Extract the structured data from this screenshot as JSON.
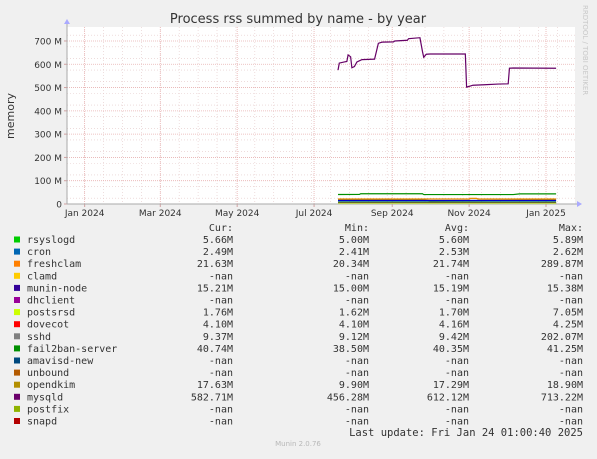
{
  "chart_data": {
    "type": "line",
    "title": "Process rss summed by name - by year",
    "ylabel": "memory",
    "watermark": "RRDTOOL / TOBI OETIKER",
    "x_tick_labels": [
      "Jan 2024",
      "Mar 2024",
      "May 2024",
      "Jul 2024",
      "Sep 2024",
      "Nov 2024",
      "Jan 2025"
    ],
    "x_ticks": [
      0,
      60,
      121,
      182,
      244,
      305,
      366
    ],
    "xlim": [
      -14,
      389
    ],
    "y_tick_labels": [
      "0",
      "100 M",
      "200 M",
      "300 M",
      "400 M",
      "500 M",
      "600 M",
      "700 M"
    ],
    "y_ticks": [
      0,
      100,
      200,
      300,
      400,
      500,
      600,
      700
    ],
    "ylim": [
      0,
      760
    ],
    "grid": true,
    "x_unit": "days since Jan 1 2024",
    "y_unit": "MB",
    "series": [
      {
        "name": "mysqld",
        "color": "#660066",
        "points": [
          [
            201,
            575
          ],
          [
            202,
            605
          ],
          [
            206,
            610
          ],
          [
            208,
            612
          ],
          [
            209,
            640
          ],
          [
            211,
            632
          ],
          [
            212,
            585
          ],
          [
            214,
            590
          ],
          [
            216,
            610
          ],
          [
            220,
            620
          ],
          [
            230,
            622
          ],
          [
            233,
            690
          ],
          [
            236,
            695
          ],
          [
            245,
            696
          ],
          [
            246,
            700
          ],
          [
            256,
            703
          ],
          [
            257,
            710
          ],
          [
            266,
            714
          ],
          [
            268,
            655
          ],
          [
            269,
            630
          ],
          [
            271,
            643
          ],
          [
            274,
            644
          ],
          [
            302,
            644
          ],
          [
            303,
            502
          ],
          [
            305,
            505
          ],
          [
            308,
            510
          ],
          [
            317,
            512
          ],
          [
            328,
            515
          ],
          [
            336,
            516
          ],
          [
            337,
            583
          ],
          [
            340,
            584
          ],
          [
            374,
            583
          ]
        ]
      },
      {
        "name": "fail2ban-server",
        "color": "#008f00",
        "points": [
          [
            201,
            40.7
          ],
          [
            218,
            41
          ],
          [
            219,
            44
          ],
          [
            268,
            44
          ],
          [
            269,
            40.5
          ],
          [
            340,
            40.5
          ],
          [
            345,
            43.5
          ],
          [
            374,
            43.5
          ]
        ]
      },
      {
        "name": "freshclam",
        "color": "#ea8f00",
        "points": [
          [
            201,
            21.6
          ],
          [
            305,
            21.6
          ],
          [
            306,
            24
          ],
          [
            311,
            24
          ],
          [
            312,
            21.6
          ],
          [
            374,
            21.6
          ]
        ]
      },
      {
        "name": "opendkim",
        "color": "#b8860b",
        "points": [
          [
            201,
            17.6
          ],
          [
            260,
            17.6
          ],
          [
            268,
            18.5
          ],
          [
            274,
            14
          ],
          [
            374,
            17.6
          ]
        ]
      },
      {
        "name": "munin-node",
        "color": "#0000cc",
        "points": [
          [
            201,
            15.2
          ],
          [
            374,
            15.2
          ]
        ]
      },
      {
        "name": "sshd",
        "color": "#006666",
        "points": [
          [
            201,
            9.4
          ],
          [
            374,
            9.4
          ]
        ]
      },
      {
        "name": "rsyslogd",
        "color": "#00cc00",
        "points": [
          [
            201,
            5.7
          ],
          [
            374,
            5.7
          ]
        ]
      },
      {
        "name": "dovecot",
        "color": "#ff0000",
        "points": [
          [
            201,
            4.1
          ],
          [
            374,
            4.1
          ]
        ]
      },
      {
        "name": "cron",
        "color": "#0066b3",
        "points": [
          [
            201,
            2.5
          ],
          [
            374,
            2.5
          ]
        ]
      },
      {
        "name": "postsrsd",
        "color": "#ccff00",
        "points": [
          [
            201,
            1.7
          ],
          [
            374,
            1.7
          ]
        ]
      }
    ],
    "legend_headers": {
      "cur": "Cur:",
      "min": "Min:",
      "avg": "Avg:",
      "max": "Max:"
    },
    "legend": [
      {
        "name": "rsyslogd",
        "color": "#00cc00",
        "cur": "5.66M",
        "min": "5.00M",
        "avg": "5.60M",
        "max": "5.89M"
      },
      {
        "name": "cron",
        "color": "#0066b3",
        "cur": "2.49M",
        "min": "2.41M",
        "avg": "2.53M",
        "max": "2.62M"
      },
      {
        "name": "freshclam",
        "color": "#ff8000",
        "cur": "21.63M",
        "min": "20.34M",
        "avg": "21.74M",
        "max": "289.87M"
      },
      {
        "name": "clamd",
        "color": "#ffcc00",
        "cur": "-nan",
        "min": "-nan",
        "avg": "-nan",
        "max": "-nan"
      },
      {
        "name": "munin-node",
        "color": "#330099",
        "cur": "15.21M",
        "min": "15.00M",
        "avg": "15.19M",
        "max": "15.38M"
      },
      {
        "name": "dhclient",
        "color": "#990099",
        "cur": "-nan",
        "min": "-nan",
        "avg": "-nan",
        "max": "-nan"
      },
      {
        "name": "postsrsd",
        "color": "#ccff00",
        "cur": "1.76M",
        "min": "1.62M",
        "avg": "1.70M",
        "max": "7.05M"
      },
      {
        "name": "dovecot",
        "color": "#ff0000",
        "cur": "4.10M",
        "min": "4.10M",
        "avg": "4.16M",
        "max": "4.25M"
      },
      {
        "name": "sshd",
        "color": "#808080",
        "cur": "9.37M",
        "min": "9.12M",
        "avg": "9.42M",
        "max": "202.07M"
      },
      {
        "name": "fail2ban-server",
        "color": "#008f00",
        "cur": "40.74M",
        "min": "38.50M",
        "avg": "40.35M",
        "max": "41.25M"
      },
      {
        "name": "amavisd-new",
        "color": "#00487d",
        "cur": "-nan",
        "min": "-nan",
        "avg": "-nan",
        "max": "-nan"
      },
      {
        "name": "unbound",
        "color": "#b35a00",
        "cur": "-nan",
        "min": "-nan",
        "avg": "-nan",
        "max": "-nan"
      },
      {
        "name": "opendkim",
        "color": "#b38f00",
        "cur": "17.63M",
        "min": "9.90M",
        "avg": "17.29M",
        "max": "18.90M"
      },
      {
        "name": "mysqld",
        "color": "#6b006b",
        "cur": "582.71M",
        "min": "456.28M",
        "avg": "612.12M",
        "max": "713.22M"
      },
      {
        "name": "postfix",
        "color": "#8fb300",
        "cur": "-nan",
        "min": "-nan",
        "avg": "-nan",
        "max": "-nan"
      },
      {
        "name": "snapd",
        "color": "#b30000",
        "cur": "-nan",
        "min": "-nan",
        "avg": "-nan",
        "max": "-nan"
      }
    ],
    "last_update": "Last update: Fri Jan 24 01:00:40 2025",
    "footer": "Munin 2.0.76"
  }
}
